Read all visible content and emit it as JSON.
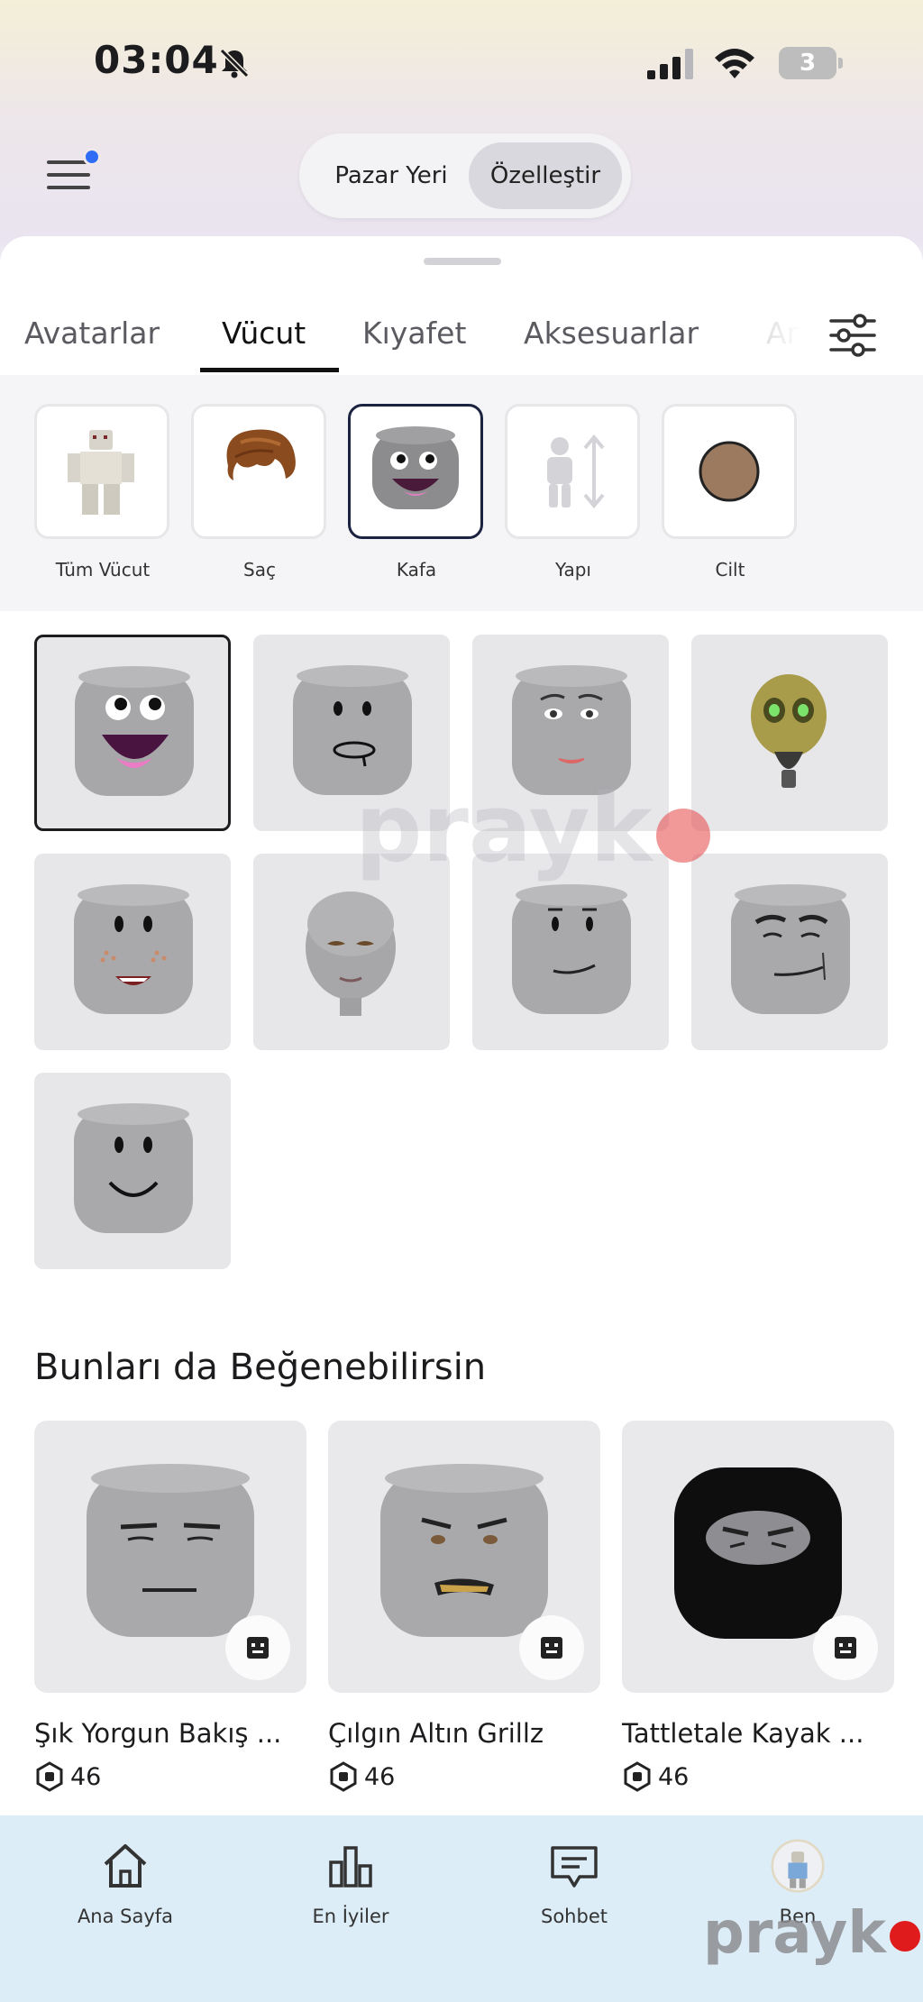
{
  "status_bar": {
    "time": "03:04",
    "battery": "3"
  },
  "header": {
    "segment_left": "Pazar Yeri",
    "segment_right": "Özelleştir"
  },
  "tabs": [
    {
      "label": "Avatarlar"
    },
    {
      "label": "Vücut"
    },
    {
      "label": "Kıyafet"
    },
    {
      "label": "Aksesuarlar"
    },
    {
      "label": "Ar"
    }
  ],
  "subcategories": [
    {
      "label": "Tüm Vücut"
    },
    {
      "label": "Saç"
    },
    {
      "label": "Kafa"
    },
    {
      "label": "Yapı"
    },
    {
      "label": "Cilt"
    }
  ],
  "colors": {
    "skin_swatch": "#9c7a5f",
    "accent_dot": "#2f6df6"
  },
  "section_title": "Bunları da Beğenebilirsin",
  "recommendations": [
    {
      "name": "Şık Yorgun Bakış ...",
      "price": "46"
    },
    {
      "name": "Çılgın Altın Grillz",
      "price": "46"
    },
    {
      "name": "Tattletale Kayak ...",
      "price": "46"
    }
  ],
  "bottom_nav": [
    {
      "label": "Ana Sayfa",
      "icon": "home-icon"
    },
    {
      "label": "En İyiler",
      "icon": "chart-icon"
    },
    {
      "label": "Sohbet",
      "icon": "chat-icon"
    },
    {
      "label": "Ben",
      "icon": "avatar-icon"
    }
  ],
  "watermark": "prayk"
}
